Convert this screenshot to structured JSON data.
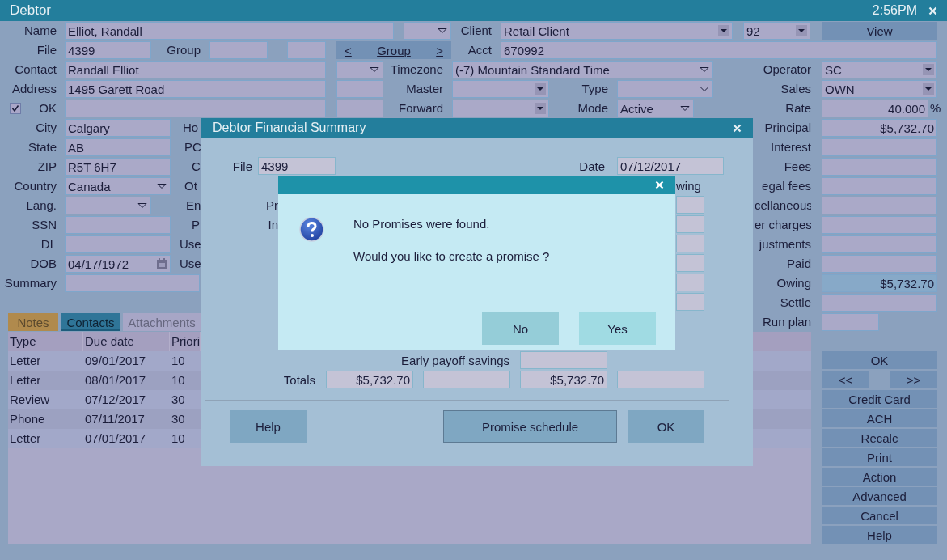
{
  "window": {
    "title": "Debtor",
    "time": "2:56PM"
  },
  "form_rows": [
    {
      "cells": [
        {
          "kind": "label",
          "text": "Name"
        },
        {
          "kind": "field",
          "value": "Elliot, Randall"
        },
        {
          "kind": "picker"
        },
        {
          "kind": "label",
          "text": "Client"
        },
        {
          "kind": "dropdown",
          "value": "Retail Client"
        },
        {
          "kind": "dropdown",
          "value": "92"
        },
        {
          "kind": "button",
          "label": "View"
        }
      ]
    },
    {
      "cells": [
        {
          "kind": "label",
          "text": "File"
        },
        {
          "kind": "field",
          "value": "4399"
        },
        {
          "kind": "label",
          "text": "Group"
        },
        {
          "kind": "field"
        },
        {
          "kind": "field"
        },
        {
          "kind": "group_nav",
          "prev": "<",
          "label": "Group",
          "next": ">"
        },
        {
          "kind": "label",
          "text": "Acct"
        },
        {
          "kind": "field",
          "value": "670992"
        }
      ]
    },
    {
      "cells": [
        {
          "kind": "label",
          "text": "Contact"
        },
        {
          "kind": "field",
          "value": "Randall Elliot"
        },
        {
          "kind": "picker"
        },
        {
          "kind": "label",
          "text": "Timezone"
        },
        {
          "kind": "picker",
          "value": "(-7) Mountain Standard Time"
        },
        {
          "kind": "label",
          "text": "Operator"
        },
        {
          "kind": "dropdown",
          "value": "SC"
        }
      ]
    },
    {
      "cells": [
        {
          "kind": "label",
          "text": "Address"
        },
        {
          "kind": "field",
          "value": "1495 Garett Road"
        },
        {
          "kind": "field"
        },
        {
          "kind": "label",
          "text": "Master"
        },
        {
          "kind": "dropdown"
        },
        {
          "kind": "label",
          "text": "Type"
        },
        {
          "kind": "picker"
        },
        {
          "kind": "label",
          "text": "Sales"
        },
        {
          "kind": "dropdown",
          "value": "OWN"
        }
      ]
    },
    {
      "cells": [
        {
          "kind": "checkbox",
          "checked": true
        },
        {
          "kind": "label",
          "text": "OK"
        },
        {
          "kind": "field"
        },
        {
          "kind": "field"
        },
        {
          "kind": "label",
          "text": "Forward"
        },
        {
          "kind": "dropdown"
        },
        {
          "kind": "label",
          "text": "Mode"
        },
        {
          "kind": "picker",
          "value": "Active"
        },
        {
          "kind": "label",
          "text": "Rate"
        },
        {
          "kind": "field",
          "value": "40.000"
        },
        {
          "kind": "label",
          "text": "%"
        }
      ]
    },
    {
      "cells": [
        {
          "kind": "label",
          "text": "City"
        },
        {
          "kind": "field",
          "value": "Calgary"
        },
        {
          "kind": "label",
          "text": "Ho"
        },
        {
          "kind": "label",
          "text": "Principal"
        },
        {
          "kind": "field",
          "value": "$5,732.70"
        }
      ]
    },
    {
      "cells": [
        {
          "kind": "label",
          "text": "State"
        },
        {
          "kind": "field",
          "value": "AB"
        },
        {
          "kind": "label",
          "text": "PC"
        },
        {
          "kind": "label",
          "text": "Interest"
        },
        {
          "kind": "field"
        }
      ]
    },
    {
      "cells": [
        {
          "kind": "label",
          "text": "ZIP"
        },
        {
          "kind": "field",
          "value": "R5T 6H7"
        },
        {
          "kind": "label",
          "text": "C"
        },
        {
          "kind": "label",
          "text": "Fees"
        },
        {
          "kind": "field"
        }
      ]
    },
    {
      "cells": [
        {
          "kind": "label",
          "text": "Country"
        },
        {
          "kind": "picker",
          "value": "Canada"
        },
        {
          "kind": "label",
          "text": "Ot"
        },
        {
          "kind": "label",
          "text": "egal fees"
        },
        {
          "kind": "field"
        }
      ]
    },
    {
      "cells": [
        {
          "kind": "label",
          "text": "Lang."
        },
        {
          "kind": "picker"
        },
        {
          "kind": "label",
          "text": "En"
        },
        {
          "kind": "label",
          "text": "cellaneous"
        },
        {
          "kind": "field"
        }
      ]
    },
    {
      "cells": [
        {
          "kind": "label",
          "text": "SSN"
        },
        {
          "kind": "field"
        },
        {
          "kind": "label",
          "text": "P"
        },
        {
          "kind": "label",
          "text": "er charges"
        },
        {
          "kind": "field"
        }
      ]
    },
    {
      "cells": [
        {
          "kind": "label",
          "text": "DL"
        },
        {
          "kind": "field"
        },
        {
          "kind": "label",
          "text": "Use"
        },
        {
          "kind": "label",
          "text": "justments"
        },
        {
          "kind": "field"
        }
      ]
    },
    {
      "cells": [
        {
          "kind": "label",
          "text": "DOB"
        },
        {
          "kind": "date",
          "value": "04/17/1972"
        },
        {
          "kind": "label",
          "text": "Use"
        },
        {
          "kind": "label",
          "text": "Paid"
        },
        {
          "kind": "field"
        }
      ]
    },
    {
      "cells": [
        {
          "kind": "label",
          "text": "Summary"
        },
        {
          "kind": "field"
        },
        {
          "kind": "label",
          "text": "Owing"
        },
        {
          "kind": "field",
          "value": "$5,732.70",
          "highlighted": true
        }
      ]
    },
    {
      "cells": [
        {
          "kind": "label",
          "text": "Settle"
        },
        {
          "kind": "field"
        }
      ]
    },
    {
      "cells": [
        {
          "kind": "tab",
          "label": "Notes",
          "selected": false,
          "disabled": false,
          "color": "#b08a4d"
        },
        {
          "kind": "tab",
          "label": "Contacts",
          "selected": true,
          "disabled": false,
          "color": "#2f7598"
        },
        {
          "kind": "tab",
          "label": "Attachments",
          "selected": false,
          "disabled": true,
          "color": "#a7a6c6"
        },
        {
          "kind": "label",
          "text": "Run plan"
        },
        {
          "kind": "field"
        }
      ]
    }
  ],
  "contacts_table": {
    "columns": [
      "Type",
      "Due date",
      "Priori"
    ],
    "rows": [
      [
        "Letter",
        "09/01/2017",
        "10"
      ],
      [
        "Letter",
        "08/01/2017",
        "10"
      ],
      [
        "Review",
        "07/12/2017",
        "30"
      ],
      [
        "Phone",
        "07/11/2017",
        "30"
      ],
      [
        "Letter",
        "07/01/2017",
        "10"
      ]
    ]
  },
  "side_buttons": [
    [
      "OK"
    ],
    [
      "<<",
      ">>"
    ],
    [
      "Credit Card"
    ],
    [
      "ACH"
    ],
    [
      "Recalc"
    ],
    [
      "Print"
    ],
    [
      "Action"
    ],
    [
      "Advanced"
    ],
    [
      "Cancel"
    ],
    [
      "Help"
    ]
  ],
  "summary_dialog": {
    "title": "Debtor Financial Summary",
    "file_label": "File",
    "file": "4399",
    "date_label": "Date",
    "date": "07/12/2017",
    "column_header": "wing",
    "rows": [
      {
        "kind": "amount",
        "label": "Pr"
      },
      {
        "kind": "amount",
        "label": "In"
      },
      {
        "kind": "amount"
      },
      {
        "kind": "amount"
      },
      {
        "kind": "amount"
      },
      {
        "kind": "amount"
      }
    ],
    "early_payoff": {
      "label": "Early payoff savings"
    },
    "totals": {
      "label": "Totals",
      "cells": [
        {
          "kind": "amount",
          "value": "$5,732.70"
        },
        {
          "kind": "amount"
        },
        {
          "kind": "amount",
          "value": "$5,732.70"
        },
        {
          "kind": "amount"
        }
      ]
    },
    "buttons": [
      {
        "label": "Help",
        "default": false
      },
      {
        "label": "Promise schedule",
        "default": true
      },
      {
        "label": "OK",
        "default": false
      }
    ]
  },
  "message_box": {
    "message": "No Promises were found.",
    "question": "Would you like to create a promise ?",
    "buttons": [
      {
        "label": "No",
        "focused": true
      },
      {
        "label": "Yes",
        "focused": false
      }
    ]
  }
}
